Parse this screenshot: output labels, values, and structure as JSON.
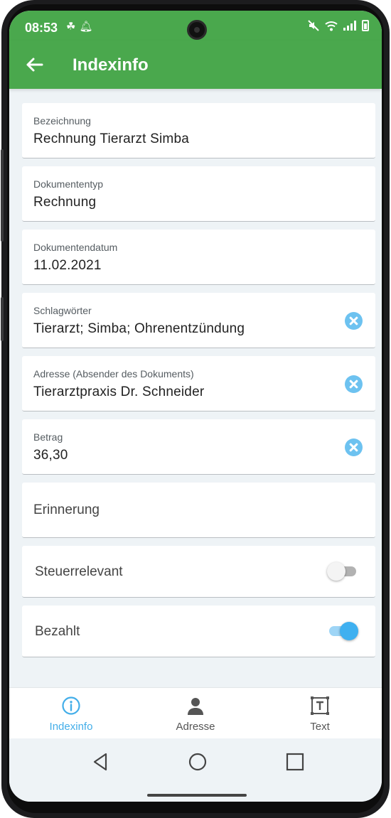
{
  "status_bar": {
    "time": "08:53",
    "left_icons": [
      "notification-icon",
      "bell-icon"
    ],
    "right_icons": [
      "mute-icon",
      "wifi-icon",
      "signal-icon",
      "battery-icon"
    ]
  },
  "app_bar": {
    "title": "Indexinfo",
    "back_icon": "arrow-left-icon"
  },
  "fields": [
    {
      "label": "Bezeichnung",
      "value": "Rechnung Tierarzt Simba",
      "clearable": false
    },
    {
      "label": "Dokumententyp",
      "value": "Rechnung",
      "clearable": false
    },
    {
      "label": "Dokumentendatum",
      "value": "11.02.2021",
      "clearable": false
    },
    {
      "label": "Schlagwörter",
      "value": "Tierarzt; Simba; Ohrenentzündung",
      "clearable": true
    },
    {
      "label": "Adresse (Absender des Dokuments)",
      "value": "Tierarztpraxis Dr. Schneider",
      "clearable": true
    },
    {
      "label": "Betrag",
      "value": "36,30",
      "clearable": true
    }
  ],
  "reminder": {
    "label": "Erinnerung"
  },
  "toggles": [
    {
      "label": "Steuerrelevant",
      "on": false
    },
    {
      "label": "Bezahlt",
      "on": true
    }
  ],
  "bottom_nav": [
    {
      "label": "Indexinfo",
      "icon": "info-circle-icon",
      "active": true
    },
    {
      "label": "Adresse",
      "icon": "person-icon",
      "active": false
    },
    {
      "label": "Text",
      "icon": "text-box-icon",
      "active": false
    }
  ],
  "colors": {
    "primary": "#4aa84d",
    "accent": "#43aee9",
    "background": "#eef3f6"
  }
}
